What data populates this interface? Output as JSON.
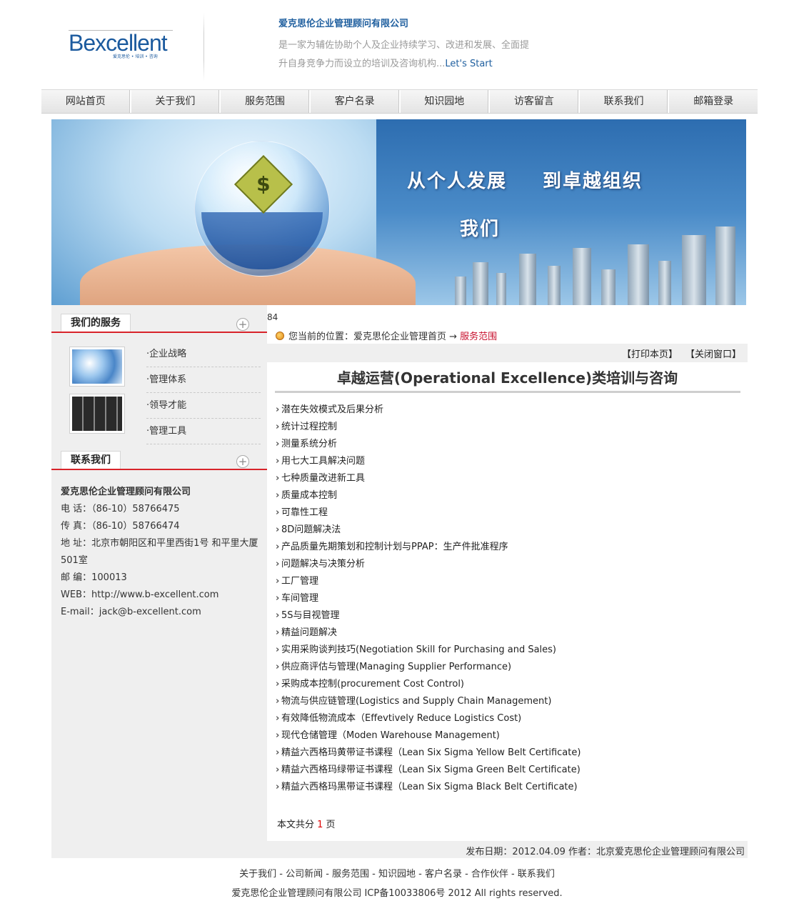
{
  "header": {
    "logo_text": "Bexcellent",
    "logo_sub": "爱克思伦 • 培训 • 咨询",
    "company_title": "爱克思伦企业管理顾问有限公司",
    "desc_line1": "是一家为辅佐协助个人及企业持续学习、改进和发展、全面提",
    "desc_line2": "升自身竞争力而设立的培训及咨询机构...",
    "desc_lets": "Let's Start"
  },
  "nav": [
    {
      "label": "网站首页"
    },
    {
      "label": "关于我们"
    },
    {
      "label": "服务范围"
    },
    {
      "label": "客户名录"
    },
    {
      "label": "知识园地"
    },
    {
      "label": "访客留言"
    },
    {
      "label": "联系我们"
    },
    {
      "label": "邮箱登录"
    }
  ],
  "banner": {
    "text1": "从个人发展",
    "text2": "到卓越组织",
    "text3": "我们",
    "chip_symbol": "$"
  },
  "sidebar": {
    "services_title": "我们的服务",
    "services": [
      {
        "label": "·企业战略"
      },
      {
        "label": "·管理体系"
      },
      {
        "label": "·领导才能"
      },
      {
        "label": "·管理工具"
      }
    ],
    "contact_title": "联系我们",
    "contact": {
      "company": "爱克思伦企业管理顾问有限公司",
      "phone": "电 话：（86-10）58766475",
      "fax": "传 真：（86-10）58766474",
      "address1": "地 址：北京市朝阳区和平里西街1号 和平里大厦",
      "address2": "501室",
      "postcode": "邮 编：100013",
      "web": "WEB：http://www.b-excellent.com",
      "email": "E-mail：jack@b-excellent.com"
    }
  },
  "main": {
    "counter": "84",
    "crumb_prefix": "您当前的位置：爱克思伦企业管理首页 → ",
    "crumb_current": "服务范围",
    "print_label": "【打印本页】",
    "close_label": "【关闭窗口】",
    "title": "卓越运营(Operational Excellence)类培训与咨询",
    "items": [
      "潜在失效模式及后果分析",
      "统计过程控制",
      "测量系统分析",
      "用七大工具解决问题",
      "七种质量改进新工具",
      "质量成本控制",
      "可靠性工程",
      "8D问题解决法",
      "产品质量先期策划和控制计划与PPAP：生产件批准程序",
      "问题解决与决策分析",
      "工厂管理",
      "车间管理",
      "5S与目视管理",
      "精益问题解决",
      "实用采购谈判技巧(Negotiation Skill for Purchasing and Sales)",
      "供应商评估与管理(Managing Supplier Performance)",
      "采购成本控制(procurement Cost Control)",
      "物流与供应链管理(Logistics and Supply Chain Management)",
      "有效降低物流成本（Effevtively Reduce Logistics Cost)",
      "现代仓储管理（Moden Warehouse Management)",
      "精益六西格玛黄带证书课程（Lean Six Sigma Yellow Belt Certificate)",
      "精益六西格玛绿带证书课程（Lean Six Sigma Green Belt Certificate)",
      "精益六西格玛黑带证书课程（Lean Six Sigma Black Belt Certificate)"
    ],
    "pages_prefix": "本文共分 ",
    "pages_num": "1",
    "pages_suffix": " 页",
    "publish": "发布日期：2012.04.09 作者：北京爱克思伦企业管理顾问有限公司"
  },
  "footer": {
    "links": "关于我们 - 公司新闻 - 服务范围 - 知识园地 - 客户名录 - 合作伙伴 - 联系我们",
    "copyright": "爱克思伦企业管理顾问有限公司 ICP备10033806号 2012 All rights reserved."
  },
  "colors": {
    "brand_blue": "#1f5f9f",
    "accent_red": "#d8232a",
    "panel_gray": "#efefef"
  }
}
